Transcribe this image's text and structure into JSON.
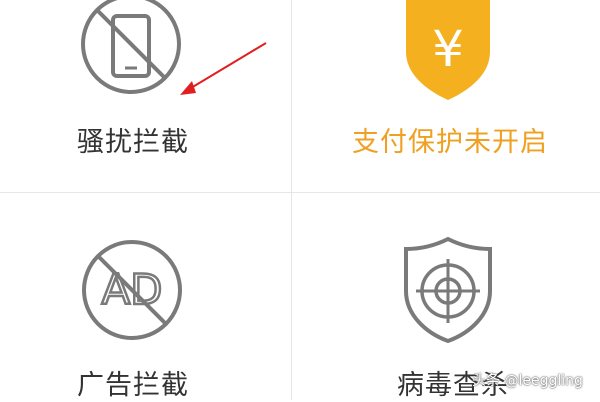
{
  "features": [
    {
      "label": "骚扰拦截",
      "icon": "no-phone-icon"
    },
    {
      "label": "支付保护未开启",
      "icon": "yuan-shield-icon"
    },
    {
      "label": "广告拦截",
      "icon": "no-ad-icon"
    },
    {
      "label": "病毒查杀",
      "icon": "target-shield-icon"
    }
  ],
  "ad_icon_text": "AD",
  "yuan_symbol": "¥",
  "watermark": "头条 @leeggling",
  "colors": {
    "warning": "#f0a020",
    "text": "#333333",
    "icon_gray": "#7a7a7a",
    "arrow": "#e02020",
    "divider": "#e6e6e6"
  }
}
